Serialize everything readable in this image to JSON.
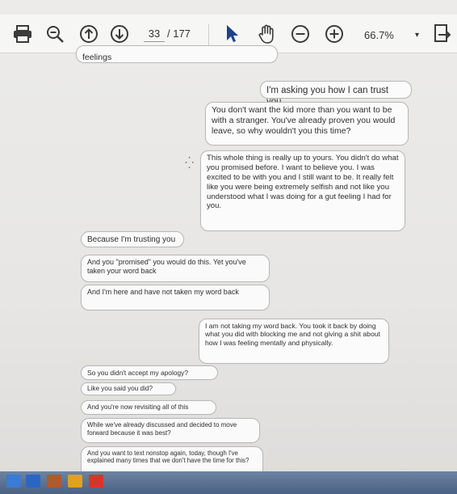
{
  "toolbar": {
    "page_current": "33",
    "page_total": "/ 177",
    "zoom": "66.7%",
    "zoom_caret": "▾"
  },
  "icons": {
    "print": "printer-icon",
    "zoom_out_search": "search-zoom-icon",
    "prev_page": "arrow-up-circle-icon",
    "next_page": "arrow-down-circle-icon",
    "select": "cursor-arrow-icon",
    "hand": "hand-icon",
    "zoom_out": "minus-circle-icon",
    "zoom_in": "plus-circle-icon",
    "fit": "fit-page-icon"
  },
  "messages": [
    {
      "side": "left",
      "text": "feelings"
    },
    {
      "side": "right",
      "text": "I'm asking you how I can trust you."
    },
    {
      "side": "right",
      "text": "You don't want the kid more than you want to be with a stranger. You've already proven you would leave, so why wouldn't you this time?"
    },
    {
      "side": "right",
      "text": "This whole thing is really up to yours. You didn't do what you promised before. I want to believe you. I was excited to be with you and I still want to be. It really felt like you were being extremely selfish and not like you understood what I was doing for a gut feeling I had for you."
    },
    {
      "side": "left",
      "text": "Because I'm trusting you"
    },
    {
      "side": "left",
      "text": "And you \"promised\" you would do this. Yet you've taken your word back"
    },
    {
      "side": "left",
      "text": "And I'm here and have not taken my word back"
    },
    {
      "side": "right",
      "text": "I am not taking my word back. You took it back by doing what you did with blocking me and not giving a shit about how I was feeling mentally and physically."
    },
    {
      "side": "left",
      "text": "So you didn't accept my apology?"
    },
    {
      "side": "left",
      "text": "Like you said you did?"
    },
    {
      "side": "left",
      "text": "And you're now revisiting all of this"
    },
    {
      "side": "left",
      "text": "While we've already discussed and decided to move forward because it was best?"
    },
    {
      "side": "left",
      "text": "And you want to text nonstop again, today, though I've explained many times that we don't have the time for this?"
    }
  ],
  "colors": {
    "toolbar_bg": "#f6f6f5",
    "bubble_bg": "#fafafa",
    "bubble_border": "#b9b9b9",
    "accent_cursor": "#1f3f8f",
    "taskbar": "#4a6283"
  }
}
